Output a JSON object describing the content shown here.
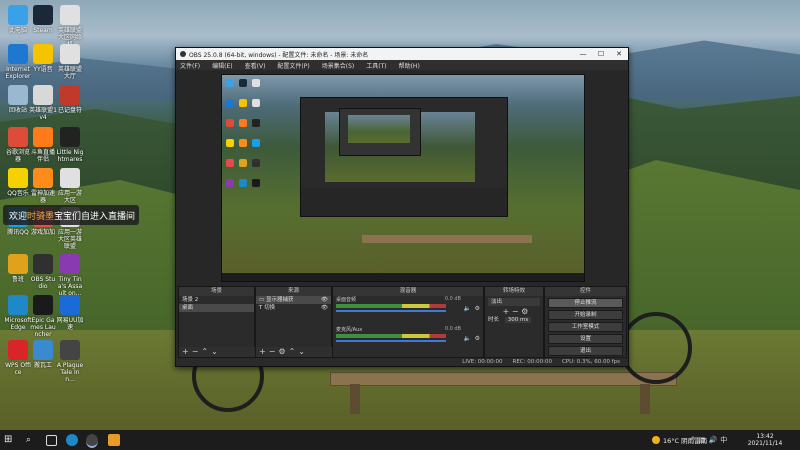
{
  "desktop": {
    "icons": [
      {
        "label": "此电脑",
        "color": "#3aa0e8"
      },
      {
        "label": "Steam",
        "color": "#1b2838"
      },
      {
        "label": "英雄联盟大区网络机",
        "color": "#e0e0e0"
      },
      {
        "label": "Internet Explorer",
        "color": "#1e78d2"
      },
      {
        "label": "YY语音",
        "color": "#f5c400"
      },
      {
        "label": "英雄联盟大厅",
        "color": "#e0e0e0"
      },
      {
        "label": "回收站",
        "color": "#9ab8d0"
      },
      {
        "label": "英雄联盟1v4",
        "color": "#d8d8d8"
      },
      {
        "label": "已记盘符",
        "color": "#c0392b"
      },
      {
        "label": "谷歌浏览器",
        "color": "#dd4b39"
      },
      {
        "label": "斗鱼直播伴侣",
        "color": "#ff7a1a"
      },
      {
        "label": "Little Nightmares",
        "color": "#222222"
      },
      {
        "label": "QQ音乐",
        "color": "#f5d100"
      },
      {
        "label": "雷神加速器",
        "color": "#ff8c1a"
      },
      {
        "label": "应用一游大区",
        "color": "#e0e0e0"
      },
      {
        "label": "腾讯QQ",
        "color": "#1aa0e8"
      },
      {
        "label": "游戏加加",
        "color": "#e84a4a"
      },
      {
        "label": "应用一游大区英雄联盟",
        "color": "#e0e0e0"
      },
      {
        "label": "鲁班",
        "color": "#e0a21a"
      },
      {
        "label": "OBS Studio",
        "color": "#303030"
      },
      {
        "label": "Tiny Tina's Assault on...",
        "color": "#8a3ab0"
      },
      {
        "label": "Microsoft Edge",
        "color": "#1e88c8"
      },
      {
        "label": "Epic Games Launcher",
        "color": "#1a1a1a"
      },
      {
        "label": "网易UU加速",
        "color": "#1a6ad8"
      },
      {
        "label": "WPS Office",
        "color": "#d8252a"
      },
      {
        "label": "搬瓦工",
        "color": "#3a8ad0"
      },
      {
        "label": "A Plague Tale Inn...",
        "color": "#444444"
      }
    ]
  },
  "chat_banner": {
    "prefix": "欢迎",
    "user": "时骑墨",
    "suffix": "宝宝们自进入直播间"
  },
  "obs": {
    "title": "OBS 25.0.8 (64-bit, windows) - 配置文件: 未命名 - 场景: 未命名",
    "menu": [
      "文件(F)",
      "编辑(E)",
      "查看(V)",
      "配置文件(P)",
      "场景集合(S)",
      "工具(T)",
      "帮助(H)"
    ],
    "docks": {
      "scenes": {
        "title": "场景",
        "items": [
          "场景 2",
          "桌面"
        ]
      },
      "sources": {
        "title": "来源",
        "items": [
          "显示器捕获",
          "切换"
        ]
      },
      "mixer": {
        "title": "混音器",
        "channels": [
          {
            "name": "桌面音频",
            "db": "0.0 dB"
          },
          {
            "name": "麦克风/Aux",
            "db": "0.0 dB"
          }
        ]
      },
      "transitions": {
        "title": "转场特效",
        "type": "淡出",
        "duration_label": "时长",
        "duration": "300 ms"
      },
      "controls": {
        "title": "控件",
        "buttons": [
          "停止推流",
          "开始录制",
          "工作室模式",
          "设置",
          "退出"
        ]
      }
    },
    "status": {
      "dropped": "LIVE: 00:00:00",
      "rec": "REC: 00:00:00",
      "cpu": "CPU: 0.3%, 60.00 fps"
    }
  },
  "taskbar": {
    "weather": "16°C 阴雨雷雨",
    "time": "13:42",
    "date": "2021/11/14"
  }
}
